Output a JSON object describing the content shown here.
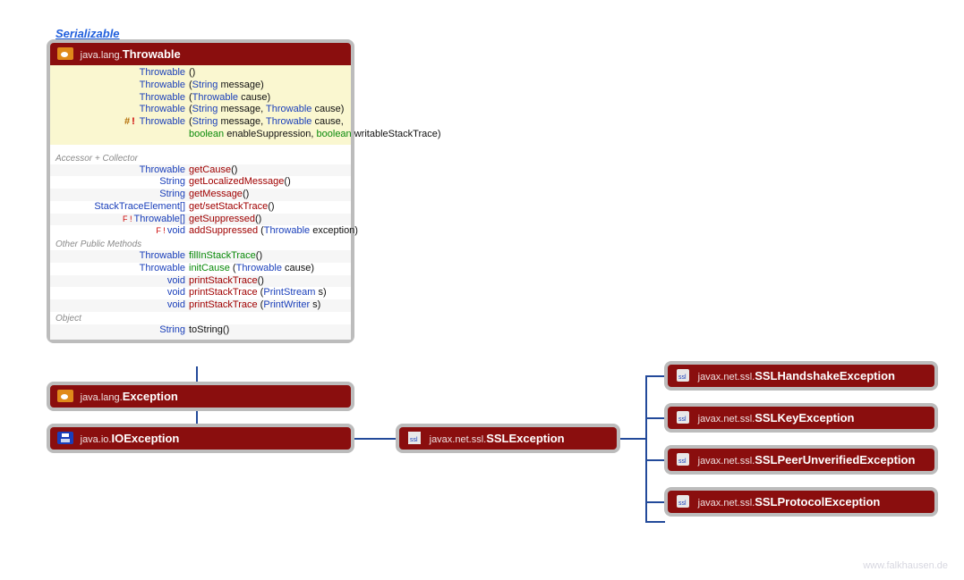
{
  "top_link": "Serializable",
  "watermark": "www.falkhausen.de",
  "throwable": {
    "pkg": "java.lang.",
    "name": "Throwable",
    "constructors": [
      {
        "sig_pre": "",
        "name": "Throwable",
        "params": "()"
      },
      {
        "sig_pre": "",
        "name": "Throwable",
        "params": "(String message)"
      },
      {
        "sig_pre": "",
        "name": "Throwable",
        "params": "(Throwable cause)"
      },
      {
        "sig_pre": "",
        "name": "Throwable",
        "params": "(String message, Throwable cause)"
      },
      {
        "sig_pre": "# !",
        "name": "Throwable",
        "params_line1": "(String message, Throwable cause,",
        "params_line2": "boolean enableSuppression, boolean writableStackTrace)"
      }
    ],
    "sections": {
      "acc_label": "Accessor + Collector",
      "acc": [
        {
          "ret": "Throwable",
          "name": "getCause",
          "params": "()",
          "style": "red"
        },
        {
          "ret": "String",
          "name": "getLocalizedMessage",
          "params": "()",
          "style": "red"
        },
        {
          "ret": "String",
          "name": "getMessage",
          "params": "()",
          "style": "red"
        },
        {
          "ret": "StackTraceElement[]",
          "name": "get/setStackTrace",
          "params": "()",
          "style": "red"
        },
        {
          "ret": "Throwable[]",
          "name": "getSuppressed",
          "params": "()",
          "style": "red",
          "flag": "F !"
        },
        {
          "ret": "void",
          "name": "addSuppressed",
          "params": "(Throwable exception)",
          "style": "red",
          "flag": "F !"
        }
      ],
      "pub_label": "Other Public Methods",
      "pub": [
        {
          "ret": "Throwable",
          "name": "fillInStackTrace",
          "params": "()",
          "style": "green"
        },
        {
          "ret": "Throwable",
          "name": "initCause",
          "params": "(Throwable cause)",
          "style": "green"
        },
        {
          "ret": "void",
          "name": "printStackTrace",
          "params": "()",
          "style": "red"
        },
        {
          "ret": "void",
          "name": "printStackTrace",
          "params": "(PrintStream s)",
          "style": "red"
        },
        {
          "ret": "void",
          "name": "printStackTrace",
          "params": "(PrintWriter s)",
          "style": "red"
        }
      ],
      "obj_label": "Object",
      "obj": [
        {
          "ret": "String",
          "name": "toString",
          "params": "()",
          "style": "black"
        }
      ]
    }
  },
  "boxes": {
    "exception": {
      "pkg": "java.lang.",
      "name": "Exception",
      "icon": "cup"
    },
    "ioexception": {
      "pkg": "java.io.",
      "name": "IOException",
      "icon": "disk"
    },
    "ssl": {
      "pkg": "javax.net.ssl.",
      "name": "SSLException",
      "icon": "doc"
    },
    "sslhand": {
      "pkg": "javax.net.ssl.",
      "name": "SSLHandshakeException",
      "icon": "doc"
    },
    "sslkey": {
      "pkg": "javax.net.ssl.",
      "name": "SSLKeyException",
      "icon": "doc"
    },
    "sslpeer": {
      "pkg": "javax.net.ssl.",
      "name": "SSLPeerUnverifiedException",
      "icon": "doc"
    },
    "sslprot": {
      "pkg": "javax.net.ssl.",
      "name": "SSLProtocolException",
      "icon": "doc"
    }
  }
}
